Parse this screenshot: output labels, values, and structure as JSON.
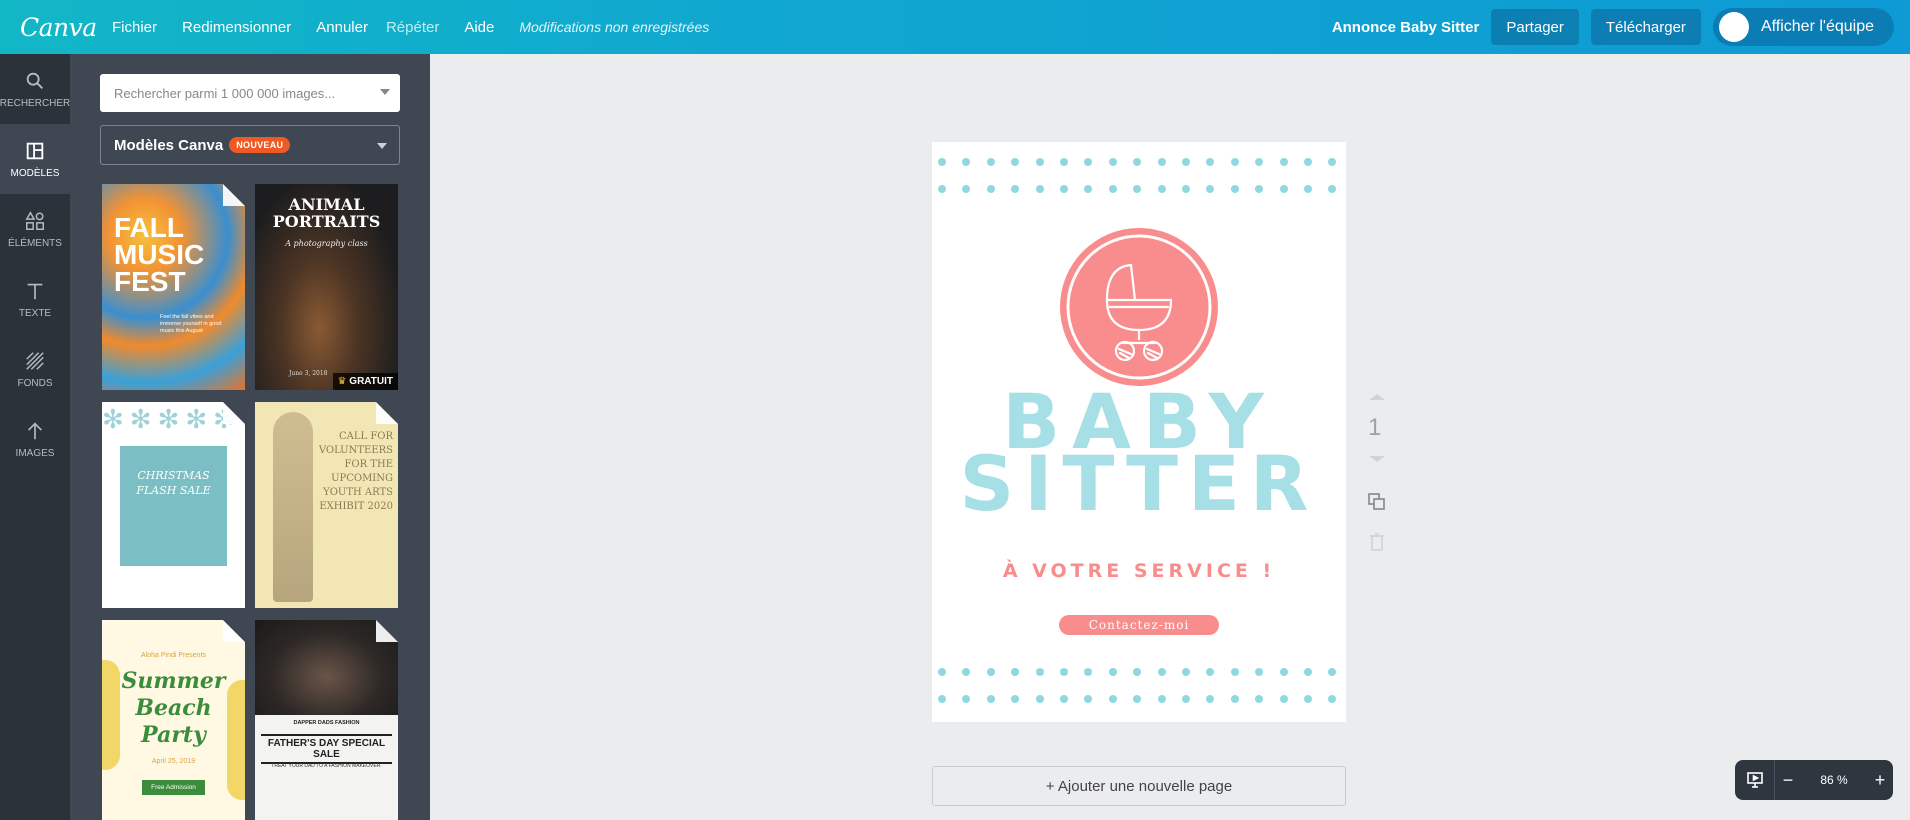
{
  "app": {
    "logo": "Canva"
  },
  "menu": {
    "fichier": "Fichier",
    "redimensionner": "Redimensionner",
    "annuler": "Annuler",
    "repeter": "Répéter",
    "aide": "Aide",
    "status": "Modifications non enregistrées"
  },
  "header": {
    "doc_title": "Annonce Baby Sitter",
    "share": "Partager",
    "download": "Télécharger",
    "team": "Afficher l'équipe"
  },
  "rail": [
    {
      "label": "RECHERCHER",
      "icon": "search-icon"
    },
    {
      "label": "MODÈLES",
      "icon": "layout-icon"
    },
    {
      "label": "ÉLÉMENTS",
      "icon": "shapes-icon"
    },
    {
      "label": "TEXTE",
      "icon": "text-icon"
    },
    {
      "label": "FONDS",
      "icon": "background-icon"
    },
    {
      "label": "IMAGES",
      "icon": "upload-icon"
    }
  ],
  "panel": {
    "search_placeholder": "Rechercher parmi 1 000 000 images...",
    "templates_label": "Modèles Canva",
    "templates_badge": "NOUVEAU"
  },
  "thumbs": {
    "t1": {
      "title": "FALL MUSIC FEST",
      "l1": "FALL",
      "l2": "MUSIC",
      "l3": "FEST",
      "small": "Feel the fall vibes and immerse yourself in good music this August"
    },
    "t2": {
      "title1": "ANIMAL",
      "title2": "PORTRAITS",
      "sub": "A photography class",
      "date": "June 3, 2018",
      "badge": "GRATUIT"
    },
    "t3": {
      "title1": "CHRISTMAS",
      "title2": "FLASH SALE"
    },
    "t4": {
      "l1": "CALL FOR",
      "l2": "VOLUNTEERS",
      "l3": "FOR THE",
      "l4": "UPCOMING",
      "l5": "YOUTH ARTS",
      "l6": "EXHIBIT 2020"
    },
    "t5": {
      "top": "Aloha Pindi Presents",
      "l1": "Summer",
      "l2": "Beach",
      "l3": "Party",
      "date": "April 25, 2019",
      "btn": "Free Admission"
    },
    "t6": {
      "top": "DAPPER DADS FASHION",
      "title": "FATHER'S DAY SPECIAL SALE",
      "sub": "TREAT YOUR DAD TO A FASHION MAKEOVER."
    }
  },
  "canvas": {
    "title_line1": "BABY",
    "title_line2": "SITTER",
    "tagline": "À VOTRE SERVICE !",
    "contact": "Contactez-moi",
    "page_number": "1",
    "add_page": "+ Ajouter une nouvelle page"
  },
  "zoom": {
    "value": "86 %",
    "minus": "−",
    "plus": "+"
  },
  "colors": {
    "accent": "#12b7c6",
    "pink": "#f98c8c",
    "teal": "#a6e0e6"
  }
}
